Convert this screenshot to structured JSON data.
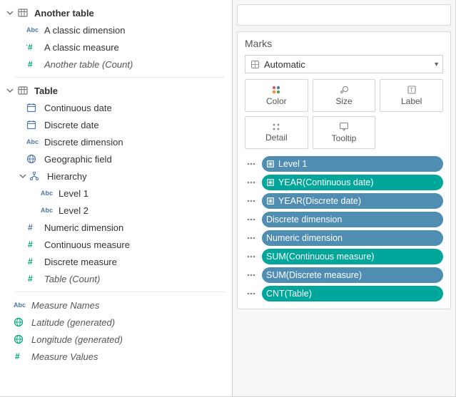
{
  "data_pane": {
    "tables": [
      {
        "name": "Another table",
        "fields": [
          {
            "id": "a-classic-dimension",
            "icon": "abc",
            "label": "A classic dimension",
            "italic": false,
            "indent": "indent-1a"
          },
          {
            "id": "a-classic-measure",
            "icon": "hash-green-t",
            "label": "A classic measure",
            "italic": false,
            "indent": "indent-1a"
          },
          {
            "id": "another-table-count",
            "icon": "hash-green",
            "label": "Another table (Count)",
            "italic": true,
            "indent": "indent-1a"
          }
        ]
      },
      {
        "name": "Table",
        "fields": [
          {
            "id": "continuous-date",
            "icon": "date",
            "label": "Continuous date",
            "italic": false,
            "indent": "indent-1a"
          },
          {
            "id": "discrete-date",
            "icon": "date",
            "label": "Discrete date",
            "italic": false,
            "indent": "indent-1a"
          },
          {
            "id": "discrete-dimension",
            "icon": "abc",
            "label": "Discrete dimension",
            "italic": false,
            "indent": "indent-1a"
          },
          {
            "id": "geographic-field",
            "icon": "globe",
            "label": "Geographic field",
            "italic": false,
            "indent": "indent-1a"
          },
          {
            "id": "hierarchy",
            "icon": "hierarchy",
            "label": "Hierarchy",
            "italic": false,
            "indent": "indent-1",
            "caret": "down"
          },
          {
            "id": "level-1",
            "icon": "abc",
            "label": "Level 1",
            "italic": false,
            "indent": "indent-2"
          },
          {
            "id": "level-2",
            "icon": "abc",
            "label": "Level 2",
            "italic": false,
            "indent": "indent-2"
          },
          {
            "id": "numeric-dimension",
            "icon": "hash-blue",
            "label": "Numeric dimension",
            "italic": false,
            "indent": "indent-1a"
          },
          {
            "id": "continuous-measure",
            "icon": "hash-green",
            "label": "Continuous measure",
            "italic": false,
            "indent": "indent-1a"
          },
          {
            "id": "discrete-measure",
            "icon": "hash-green",
            "label": "Discrete measure",
            "italic": false,
            "indent": "indent-1a"
          },
          {
            "id": "table-count",
            "icon": "hash-green",
            "label": "Table (Count)",
            "italic": true,
            "indent": "indent-1a"
          }
        ]
      }
    ],
    "generated": [
      {
        "id": "measure-names",
        "icon": "abc",
        "label": "Measure Names",
        "italic": true
      },
      {
        "id": "latitude-generated",
        "icon": "globe-green",
        "label": "Latitude (generated)",
        "italic": true
      },
      {
        "id": "longitude-generated",
        "icon": "globe-green",
        "label": "Longitude (generated)",
        "italic": true
      },
      {
        "id": "measure-values",
        "icon": "hash-green",
        "label": "Measure Values",
        "italic": true
      }
    ]
  },
  "marks_card": {
    "title": "Marks",
    "mark_type": "Automatic",
    "buttons": [
      {
        "id": "color",
        "label": "Color"
      },
      {
        "id": "size",
        "label": "Size"
      },
      {
        "id": "label",
        "label": "Label"
      },
      {
        "id": "detail",
        "label": "Detail"
      },
      {
        "id": "tooltip",
        "label": "Tooltip"
      }
    ],
    "pills": [
      {
        "label": "Level 1",
        "color": "blue",
        "expand": true
      },
      {
        "label": "YEAR(Continuous date)",
        "color": "green",
        "expand": true
      },
      {
        "label": "YEAR(Discrete date)",
        "color": "blue",
        "expand": true
      },
      {
        "label": "Discrete dimension",
        "color": "blue",
        "expand": false
      },
      {
        "label": "Numeric dimension",
        "color": "blue",
        "expand": false
      },
      {
        "label": "SUM(Continuous measure)",
        "color": "green",
        "expand": false
      },
      {
        "label": "SUM(Discrete measure)",
        "color": "blue",
        "expand": false
      },
      {
        "label": "CNT(Table)",
        "color": "green",
        "expand": false
      }
    ]
  }
}
